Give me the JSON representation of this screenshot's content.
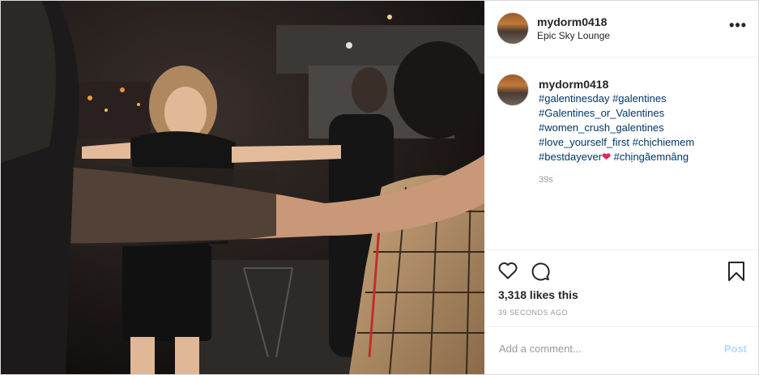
{
  "header": {
    "username": "mydorm0418",
    "location": "Epic Sky Lounge",
    "more_icon": "more-options-icon"
  },
  "caption": {
    "username": "mydorm0418",
    "lines": [
      "#galentinesday #galentines",
      "#Galentines_or_Valentines",
      "#women_crush_galentines",
      "#love_yourself_first #chịchiemem",
      "#bestdayever",
      "#chịngãemnâng"
    ],
    "emoji": "❤",
    "age": "39s"
  },
  "actions": {
    "like_icon": "heart-icon",
    "comment_icon": "comment-icon",
    "save_icon": "bookmark-icon",
    "likes": "3,318 likes this",
    "timestamp": "39 SECONDS AGO"
  },
  "add_comment": {
    "placeholder": "Add a comment...",
    "post_label": "Post"
  },
  "colors": {
    "hashtag": "#003569",
    "post_disabled": "#b3dbff",
    "heart_emoji": "#e0245e"
  }
}
